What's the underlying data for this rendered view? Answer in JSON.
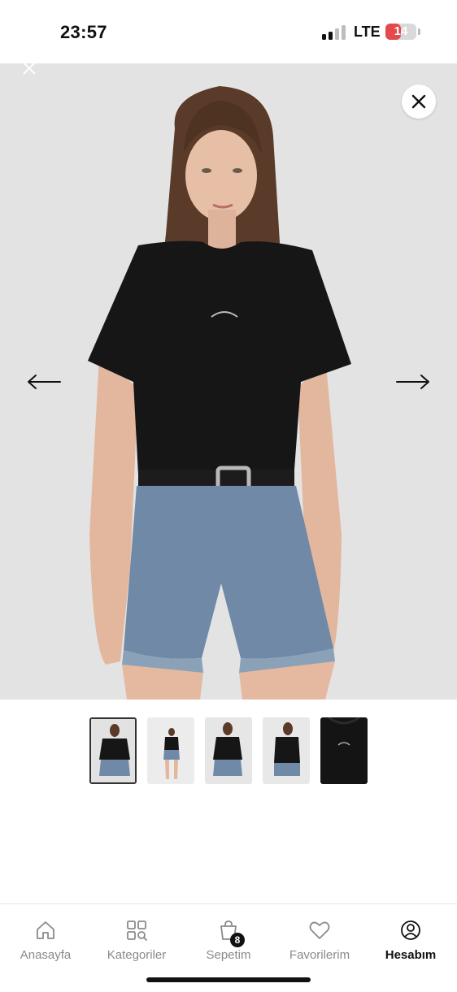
{
  "status_bar": {
    "time": "23:57",
    "network": "LTE",
    "battery": "14",
    "battery_level": 0.14,
    "signal_bars_active": 2,
    "signal_bars_total": 4
  },
  "gallery": {
    "close_icon": "close-icon",
    "prev_icon": "arrow-left-icon",
    "next_icon": "arrow-right-icon",
    "current_index": 1,
    "thumbnail_count": 5
  },
  "tab_bar": {
    "items": [
      {
        "label": "Anasayfa",
        "icon": "home-icon",
        "active": false
      },
      {
        "label": "Kategoriler",
        "icon": "categories-icon",
        "active": false
      },
      {
        "label": "Sepetim",
        "icon": "cart-icon",
        "active": false
      },
      {
        "label": "Favorilerim",
        "icon": "heart-icon",
        "active": false
      },
      {
        "label": "Hesabım",
        "icon": "account-icon",
        "active": true
      }
    ],
    "cart_badge": "8"
  },
  "colors": {
    "accent": "#111111",
    "inactive": "#8a8a8a",
    "battery_low": "#e5484d",
    "image_bg": "#e3e3e3"
  }
}
